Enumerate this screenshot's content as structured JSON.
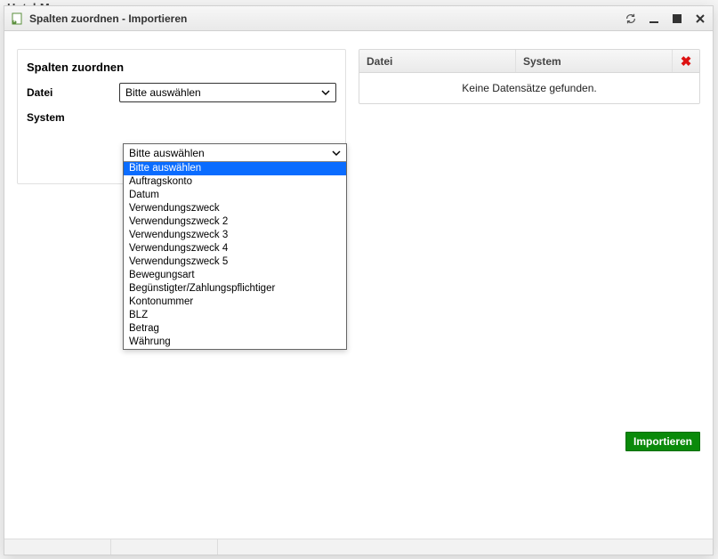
{
  "bg_window_title": "Hotel-Manager",
  "dialog": {
    "title": "Spalten zuordnen - Importieren"
  },
  "left": {
    "heading": "Spalten zuordnen",
    "rows": {
      "datei": {
        "label": "Datei",
        "value": "Bitte auswählen"
      },
      "system": {
        "label": "System",
        "value": "Bitte auswählen"
      }
    }
  },
  "dropdown": {
    "header": "Bitte auswählen",
    "selected_index": 0,
    "options": [
      "Bitte auswählen",
      "Auftragskonto",
      "Datum",
      "Verwendungszweck",
      "Verwendungszweck 2",
      "Verwendungszweck 3",
      "Verwendungszweck 4",
      "Verwendungszweck 5",
      "Bewegungsart",
      "Begünstigter/Zahlungspflichtiger",
      "Kontonummer",
      "BLZ",
      "Betrag",
      "Währung"
    ]
  },
  "table": {
    "columns": {
      "datei": "Datei",
      "system": "System"
    },
    "delete_icon": "✖",
    "empty": "Keine Datensätze gefunden."
  },
  "buttons": {
    "import": "Importieren"
  }
}
